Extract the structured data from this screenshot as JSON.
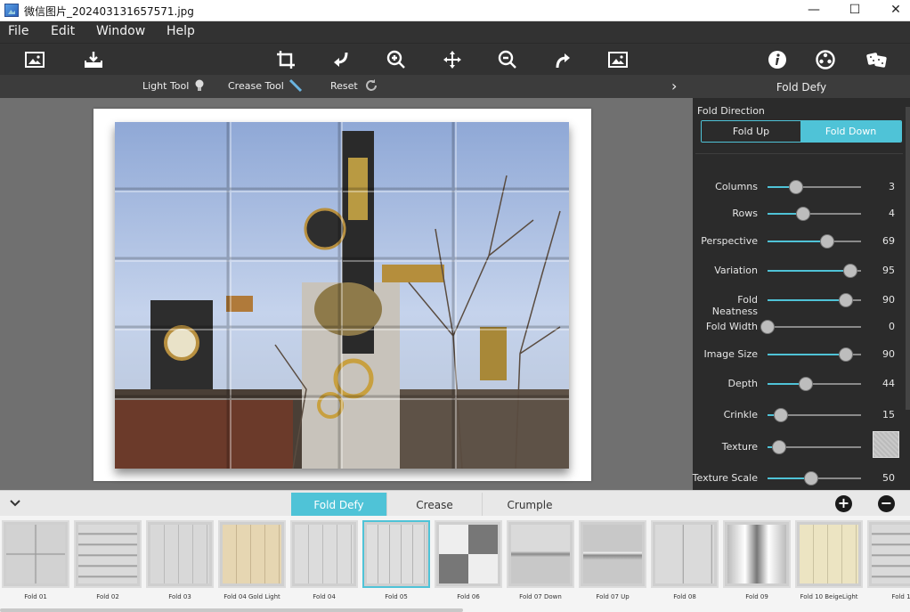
{
  "window": {
    "title": "微信图片_202403131657571.jpg",
    "minimize": "—",
    "maximize": "☐",
    "close": "✕"
  },
  "menu": [
    "File",
    "Edit",
    "Window",
    "Help"
  ],
  "toolbar_icons": [
    "open-image-icon",
    "save-image-icon",
    "crop-icon",
    "rotate-left-icon",
    "zoom-in-icon",
    "move-icon",
    "zoom-out-icon",
    "rotate-right-icon",
    "fit-image-icon",
    "info-icon",
    "effects-icon",
    "random-dice-icon"
  ],
  "options": {
    "light_tool": "Light Tool",
    "crease_tool": "Crease Tool",
    "reset": "Reset",
    "expand": "›"
  },
  "panel": {
    "header": "Fold Defy",
    "fold_direction_label": "Fold Direction",
    "fold_up": "Fold Up",
    "fold_down": "Fold Down",
    "selected_direction": "Fold Down",
    "sliders": [
      {
        "name": "Columns",
        "value": "3",
        "fraction": 0.3
      },
      {
        "name": "Rows",
        "value": "4",
        "fraction": 0.38
      },
      {
        "name": "Perspective",
        "value": "69",
        "fraction": 0.64
      },
      {
        "name": "Variation",
        "value": "95",
        "fraction": 0.89
      },
      {
        "name": "Fold Neatness",
        "value": "90",
        "fraction": 0.84
      },
      {
        "name": "Fold Width",
        "value": "0",
        "fraction": 0.0
      },
      {
        "name": "Image Size",
        "value": "90",
        "fraction": 0.84
      },
      {
        "name": "Depth",
        "value": "44",
        "fraction": 0.41
      },
      {
        "name": "Crinkle",
        "value": "15",
        "fraction": 0.14
      },
      {
        "name": "Texture",
        "value": "",
        "fraction": 0.12
      },
      {
        "name": "Texture Scale",
        "value": "50",
        "fraction": 0.47
      }
    ]
  },
  "bottom": {
    "tabs": [
      "Fold Defy",
      "Crease",
      "Crumple"
    ],
    "active_tab": "Fold Defy",
    "add": "+",
    "remove": "−",
    "collapse": "⌄"
  },
  "presets": [
    {
      "label": "Fold 01",
      "selected": false
    },
    {
      "label": "Fold 02",
      "selected": false
    },
    {
      "label": "Fold 03",
      "selected": false
    },
    {
      "label": "Fold 04 Gold Light",
      "selected": false
    },
    {
      "label": "Fold 04",
      "selected": false
    },
    {
      "label": "Fold 05",
      "selected": true
    },
    {
      "label": "Fold 06",
      "selected": false
    },
    {
      "label": "Fold 07 Down",
      "selected": false
    },
    {
      "label": "Fold 07 Up",
      "selected": false
    },
    {
      "label": "Fold 08",
      "selected": false
    },
    {
      "label": "Fold 09",
      "selected": false
    },
    {
      "label": "Fold 10 BeigeLight",
      "selected": false
    },
    {
      "label": "Fold 1",
      "selected": false
    }
  ],
  "colors": {
    "accent": "#4fc3d7",
    "toolbar": "#323232",
    "panel": "#2b2b2b"
  }
}
